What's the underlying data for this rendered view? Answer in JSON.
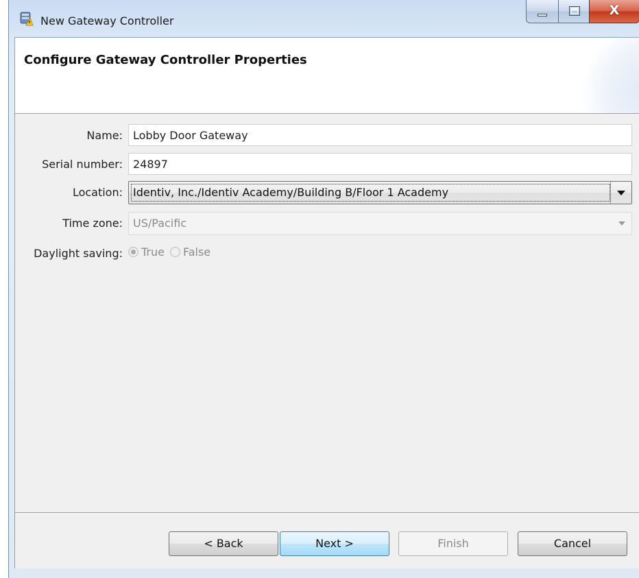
{
  "window": {
    "title": "New Gateway Controller",
    "icon": "gateway-controller-icon",
    "close_glyph": "X"
  },
  "header": {
    "title": "Configure Gateway Controller Properties"
  },
  "form": {
    "name": {
      "label": "Name:",
      "value": "Lobby Door Gateway"
    },
    "serial_number": {
      "label": "Serial number:",
      "value": "24897"
    },
    "location": {
      "label": "Location:",
      "value": "Identiv, Inc./Identiv Academy/Building B/Floor 1 Academy"
    },
    "time_zone": {
      "label": "Time zone:",
      "value": "US/Pacific",
      "enabled": false
    },
    "daylight_saving": {
      "label": "Daylight saving:",
      "options": [
        {
          "label": "True",
          "checked": true
        },
        {
          "label": "False",
          "checked": false
        }
      ],
      "enabled": false
    }
  },
  "buttons": {
    "back": {
      "label": "< Back",
      "mnemonic": "B"
    },
    "next": {
      "label": "Next >",
      "mnemonic": "N"
    },
    "finish": {
      "label": "Finish",
      "mnemonic": "F",
      "enabled": false
    },
    "cancel": {
      "label": "Cancel"
    }
  },
  "colors": {
    "default_button_border": "#3c7fb1",
    "close_button": "#c2391c",
    "disabled_text": "#8a8a8a"
  }
}
